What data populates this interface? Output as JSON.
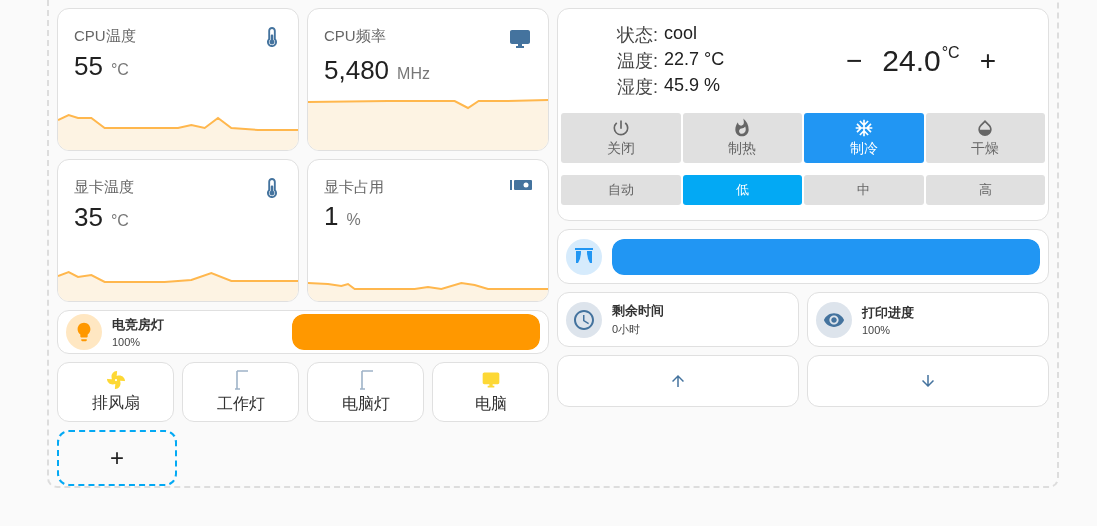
{
  "sensors": [
    {
      "name": "CPU温度",
      "value": "55",
      "unit": "°C"
    },
    {
      "name": "CPU频率",
      "value": "5,480",
      "unit": "MHz"
    },
    {
      "name": "显卡温度",
      "value": "35",
      "unit": "°C"
    },
    {
      "name": "显卡占用",
      "value": "1",
      "unit": "%"
    }
  ],
  "light": {
    "name": "电竞房灯",
    "state": "100%",
    "level": 1
  },
  "buttons": [
    {
      "label": "排风扇",
      "on": true
    },
    {
      "label": "工作灯",
      "on": false
    },
    {
      "label": "电脑灯",
      "on": false
    },
    {
      "label": "电脑",
      "on": true
    }
  ],
  "add_button": "+",
  "climate": {
    "info": [
      {
        "label": "状态:",
        "value": "cool"
      },
      {
        "label": "温度:",
        "value": "22.7 °C"
      },
      {
        "label": "湿度:",
        "value": "45.9 %"
      }
    ],
    "minus": "−",
    "target": "24.0",
    "target_unit": "°C",
    "plus": "+",
    "hvac_modes": [
      {
        "label": "关闭",
        "selected": false
      },
      {
        "label": "制热",
        "selected": false
      },
      {
        "label": "制冷",
        "selected": true
      },
      {
        "label": "干燥",
        "selected": false
      }
    ],
    "fan_modes": [
      {
        "label": "自动",
        "selected": false
      },
      {
        "label": "低",
        "selected": true
      },
      {
        "label": "中",
        "selected": false
      },
      {
        "label": "高",
        "selected": false
      }
    ]
  },
  "cover": {
    "level": 1
  },
  "printer": [
    {
      "name": "剩余时间",
      "state": "0小时"
    },
    {
      "name": "打印进度",
      "state": "100%"
    }
  ]
}
